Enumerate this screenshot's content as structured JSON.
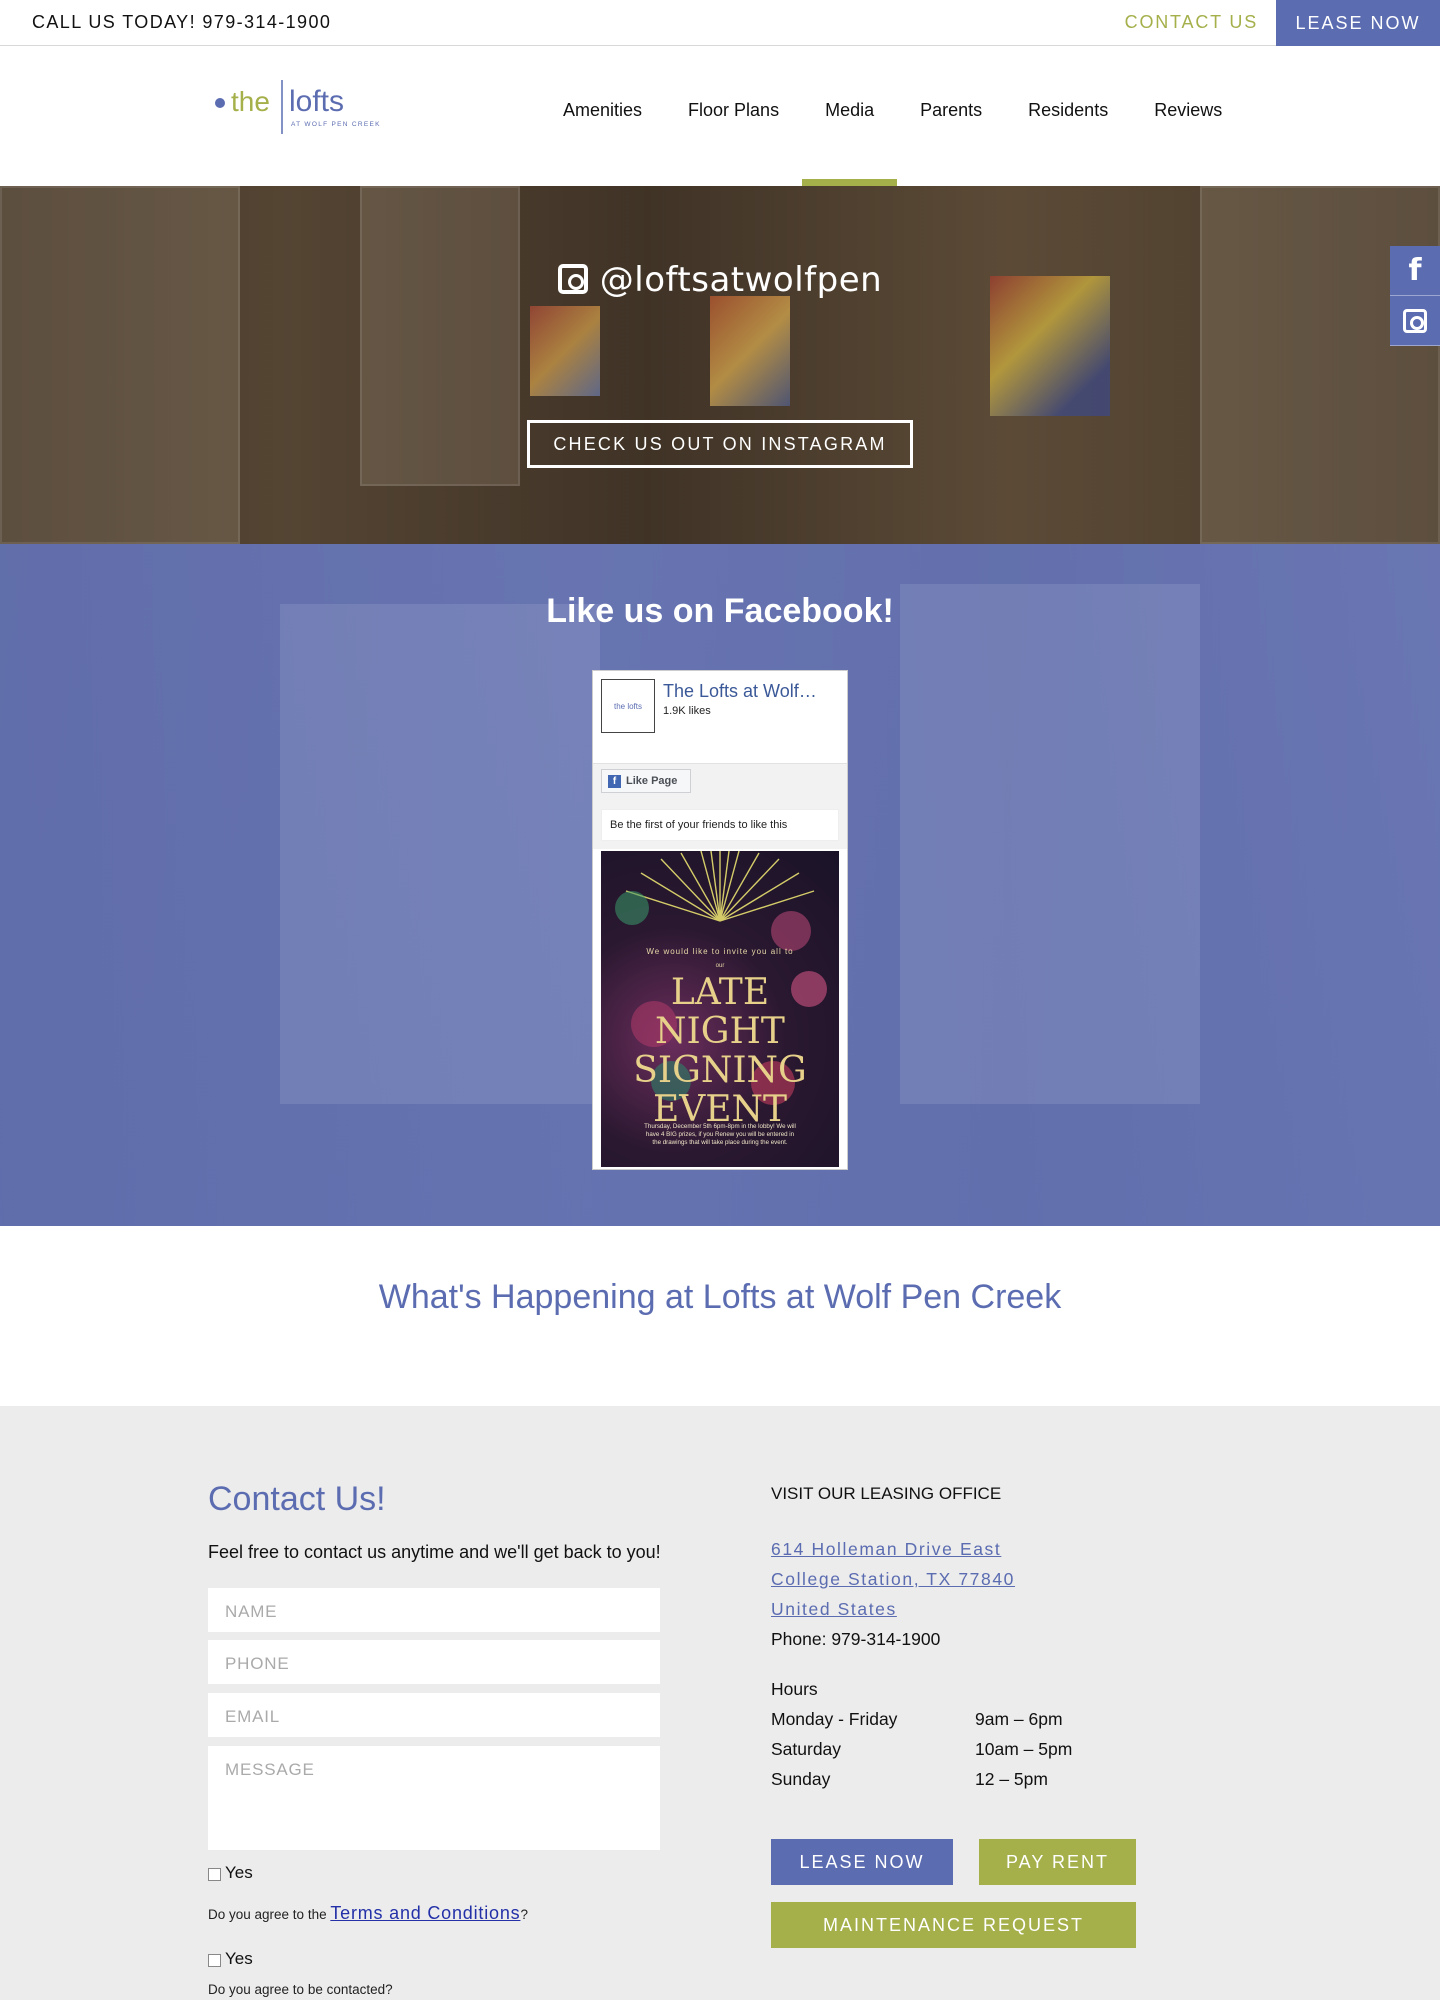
{
  "topbar": {
    "call_text": "CALL US TODAY! 979-314-1900",
    "contact_label": "CONTACT US",
    "lease_label": "LEASE NOW"
  },
  "header": {
    "logo_main": "the lofts",
    "logo_sub": "AT WOLF PEN CREEK",
    "nav": [
      {
        "label": "Amenities"
      },
      {
        "label": "Floor Plans"
      },
      {
        "label": "Media",
        "active": true
      },
      {
        "label": "Parents"
      },
      {
        "label": "Residents"
      },
      {
        "label": "Reviews"
      }
    ]
  },
  "instagram": {
    "handle": "@loftsatwolfpen",
    "button_label": "CHECK US OUT ON INSTAGRAM"
  },
  "social": {
    "facebook_glyph": "f",
    "icons": [
      "facebook-icon",
      "instagram-icon"
    ]
  },
  "facebook": {
    "title": "Like us on Facebook!",
    "widget": {
      "page_name": "The Lofts at Wolf…",
      "likes": "1.9K likes",
      "like_button": "Like Page",
      "friends_text": "Be the first of your friends to like this",
      "post": {
        "invite": "We would like to invite you all to",
        "our": "our",
        "headline": [
          "LATE",
          "NIGHT",
          "SIGNING",
          "EVENT"
        ],
        "details": "Thursday, December 5th 6pm-8pm in the lobby! We will have 4 BIG prizes, if you Renew you will be entered in the drawings that will take place during the event."
      }
    }
  },
  "happening": {
    "title": "What's Happening at Lofts at Wolf Pen Creek"
  },
  "contact": {
    "title": "Contact Us!",
    "lead": "Feel free to contact us anytime and we'll get back to you!",
    "placeholders": {
      "name": "NAME",
      "phone": "PHONE",
      "email": "EMAIL",
      "message": "MESSAGE"
    },
    "yes_label": "Yes",
    "agree_terms_prefix": "Do you agree to the ",
    "terms_link": "Terms and Conditions",
    "agree_terms_suffix": "?",
    "agree_contact": "Do you agree to be contacted?"
  },
  "office": {
    "heading": "VISIT OUR LEASING OFFICE",
    "address": [
      "614 Holleman Drive East",
      "College Station, TX 77840",
      "United States"
    ],
    "phone": "Phone: 979-314-1900",
    "hours_heading": "Hours",
    "hours": [
      {
        "day": "Monday - Friday",
        "time": "9am – 6pm"
      },
      {
        "day": "Saturday",
        "time": "10am – 5pm"
      },
      {
        "day": "Sunday",
        "time": "12 – 5pm"
      }
    ],
    "buttons": {
      "lease": "LEASE NOW",
      "pay": "PAY RENT",
      "maintenance": "MAINTENANCE REQUEST"
    }
  },
  "colors": {
    "brand_blue": "#5b6cb1",
    "brand_green": "#a5b04b"
  }
}
